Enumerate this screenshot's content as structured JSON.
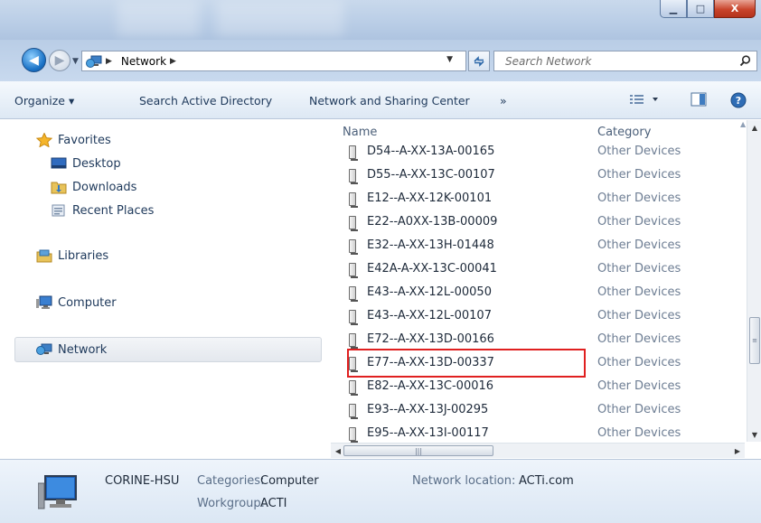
{
  "window": {
    "minimize_glyph": "▁",
    "maximize_glyph": "□",
    "close_glyph": "X"
  },
  "address": {
    "crumb_arrow": "▶",
    "location": "Network",
    "search_placeholder": "Search Network"
  },
  "toolbar": {
    "organize": "Organize ▾",
    "search_ad": "Search Active Directory",
    "network_sharing": "Network and Sharing Center",
    "overflow": "»"
  },
  "sidebar": {
    "favorites": "Favorites",
    "desktop": "Desktop",
    "downloads": "Downloads",
    "recent_places": "Recent Places",
    "libraries": "Libraries",
    "computer": "Computer",
    "network": "Network"
  },
  "list": {
    "columns": {
      "name": "Name",
      "category": "Category"
    },
    "rows": [
      {
        "name": "D54--A-XX-13A-00165",
        "category": "Other Devices"
      },
      {
        "name": "D55--A-XX-13C-00107",
        "category": "Other Devices"
      },
      {
        "name": "E12--A-XX-12K-00101",
        "category": "Other Devices"
      },
      {
        "name": "E22--A0XX-13B-00009",
        "category": "Other Devices"
      },
      {
        "name": "E32--A-XX-13H-01448",
        "category": "Other Devices"
      },
      {
        "name": "E42A-A-XX-13C-00041",
        "category": "Other Devices"
      },
      {
        "name": "E43--A-XX-12L-00050",
        "category": "Other Devices"
      },
      {
        "name": "E43--A-XX-12L-00107",
        "category": "Other Devices"
      },
      {
        "name": "E72--A-XX-13D-00166",
        "category": "Other Devices"
      },
      {
        "name": "E77--A-XX-13D-00337",
        "category": "Other Devices"
      },
      {
        "name": "E82--A-XX-13C-00016",
        "category": "Other Devices"
      },
      {
        "name": "E93--A-XX-13J-00295",
        "category": "Other Devices"
      },
      {
        "name": "E95--A-XX-13I-00117",
        "category": "Other Devices"
      }
    ]
  },
  "details": {
    "computer_name": "CORINE-HSU",
    "categories_label": "Categories:",
    "categories_value": "Computer",
    "workgroup_label": "Workgroup:",
    "workgroup_value": "ACTI",
    "location_label": "Network location:",
    "location_value": "ACTi.com"
  },
  "colors": {
    "highlight_box": "#e02020",
    "link_text": "#1e395b"
  }
}
